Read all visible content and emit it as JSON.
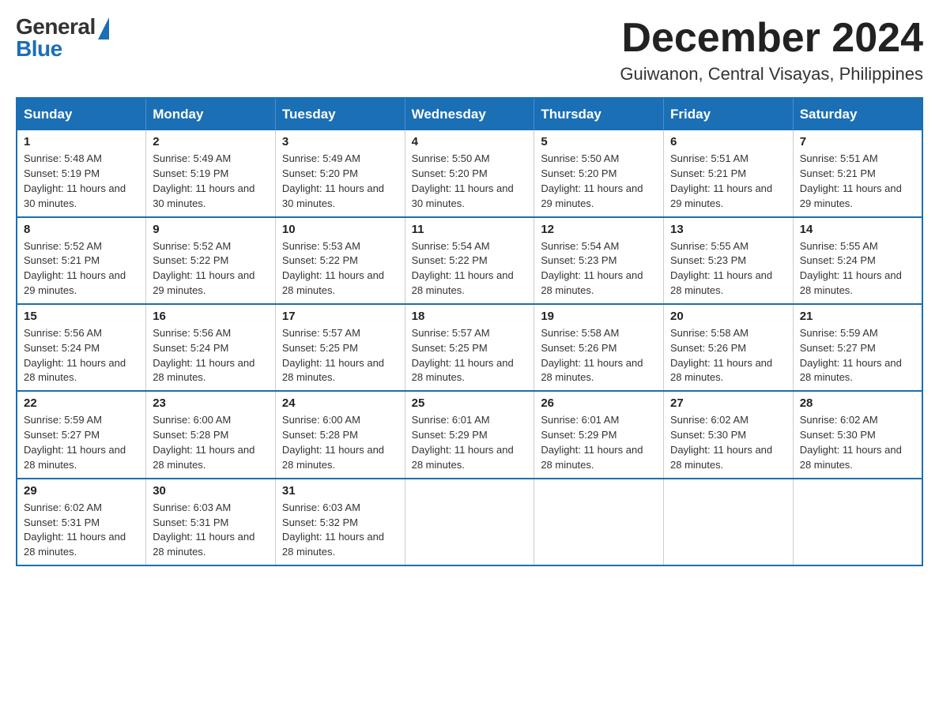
{
  "header": {
    "logo_general": "General",
    "logo_blue": "Blue",
    "month_title": "December 2024",
    "location": "Guiwanon, Central Visayas, Philippines"
  },
  "weekdays": [
    "Sunday",
    "Monday",
    "Tuesday",
    "Wednesday",
    "Thursday",
    "Friday",
    "Saturday"
  ],
  "weeks": [
    [
      {
        "day": "1",
        "sunrise": "5:48 AM",
        "sunset": "5:19 PM",
        "daylight": "11 hours and 30 minutes."
      },
      {
        "day": "2",
        "sunrise": "5:49 AM",
        "sunset": "5:19 PM",
        "daylight": "11 hours and 30 minutes."
      },
      {
        "day": "3",
        "sunrise": "5:49 AM",
        "sunset": "5:20 PM",
        "daylight": "11 hours and 30 minutes."
      },
      {
        "day": "4",
        "sunrise": "5:50 AM",
        "sunset": "5:20 PM",
        "daylight": "11 hours and 30 minutes."
      },
      {
        "day": "5",
        "sunrise": "5:50 AM",
        "sunset": "5:20 PM",
        "daylight": "11 hours and 29 minutes."
      },
      {
        "day": "6",
        "sunrise": "5:51 AM",
        "sunset": "5:21 PM",
        "daylight": "11 hours and 29 minutes."
      },
      {
        "day": "7",
        "sunrise": "5:51 AM",
        "sunset": "5:21 PM",
        "daylight": "11 hours and 29 minutes."
      }
    ],
    [
      {
        "day": "8",
        "sunrise": "5:52 AM",
        "sunset": "5:21 PM",
        "daylight": "11 hours and 29 minutes."
      },
      {
        "day": "9",
        "sunrise": "5:52 AM",
        "sunset": "5:22 PM",
        "daylight": "11 hours and 29 minutes."
      },
      {
        "day": "10",
        "sunrise": "5:53 AM",
        "sunset": "5:22 PM",
        "daylight": "11 hours and 28 minutes."
      },
      {
        "day": "11",
        "sunrise": "5:54 AM",
        "sunset": "5:22 PM",
        "daylight": "11 hours and 28 minutes."
      },
      {
        "day": "12",
        "sunrise": "5:54 AM",
        "sunset": "5:23 PM",
        "daylight": "11 hours and 28 minutes."
      },
      {
        "day": "13",
        "sunrise": "5:55 AM",
        "sunset": "5:23 PM",
        "daylight": "11 hours and 28 minutes."
      },
      {
        "day": "14",
        "sunrise": "5:55 AM",
        "sunset": "5:24 PM",
        "daylight": "11 hours and 28 minutes."
      }
    ],
    [
      {
        "day": "15",
        "sunrise": "5:56 AM",
        "sunset": "5:24 PM",
        "daylight": "11 hours and 28 minutes."
      },
      {
        "day": "16",
        "sunrise": "5:56 AM",
        "sunset": "5:24 PM",
        "daylight": "11 hours and 28 minutes."
      },
      {
        "day": "17",
        "sunrise": "5:57 AM",
        "sunset": "5:25 PM",
        "daylight": "11 hours and 28 minutes."
      },
      {
        "day": "18",
        "sunrise": "5:57 AM",
        "sunset": "5:25 PM",
        "daylight": "11 hours and 28 minutes."
      },
      {
        "day": "19",
        "sunrise": "5:58 AM",
        "sunset": "5:26 PM",
        "daylight": "11 hours and 28 minutes."
      },
      {
        "day": "20",
        "sunrise": "5:58 AM",
        "sunset": "5:26 PM",
        "daylight": "11 hours and 28 minutes."
      },
      {
        "day": "21",
        "sunrise": "5:59 AM",
        "sunset": "5:27 PM",
        "daylight": "11 hours and 28 minutes."
      }
    ],
    [
      {
        "day": "22",
        "sunrise": "5:59 AM",
        "sunset": "5:27 PM",
        "daylight": "11 hours and 28 minutes."
      },
      {
        "day": "23",
        "sunrise": "6:00 AM",
        "sunset": "5:28 PM",
        "daylight": "11 hours and 28 minutes."
      },
      {
        "day": "24",
        "sunrise": "6:00 AM",
        "sunset": "5:28 PM",
        "daylight": "11 hours and 28 minutes."
      },
      {
        "day": "25",
        "sunrise": "6:01 AM",
        "sunset": "5:29 PM",
        "daylight": "11 hours and 28 minutes."
      },
      {
        "day": "26",
        "sunrise": "6:01 AM",
        "sunset": "5:29 PM",
        "daylight": "11 hours and 28 minutes."
      },
      {
        "day": "27",
        "sunrise": "6:02 AM",
        "sunset": "5:30 PM",
        "daylight": "11 hours and 28 minutes."
      },
      {
        "day": "28",
        "sunrise": "6:02 AM",
        "sunset": "5:30 PM",
        "daylight": "11 hours and 28 minutes."
      }
    ],
    [
      {
        "day": "29",
        "sunrise": "6:02 AM",
        "sunset": "5:31 PM",
        "daylight": "11 hours and 28 minutes."
      },
      {
        "day": "30",
        "sunrise": "6:03 AM",
        "sunset": "5:31 PM",
        "daylight": "11 hours and 28 minutes."
      },
      {
        "day": "31",
        "sunrise": "6:03 AM",
        "sunset": "5:32 PM",
        "daylight": "11 hours and 28 minutes."
      },
      null,
      null,
      null,
      null
    ]
  ]
}
